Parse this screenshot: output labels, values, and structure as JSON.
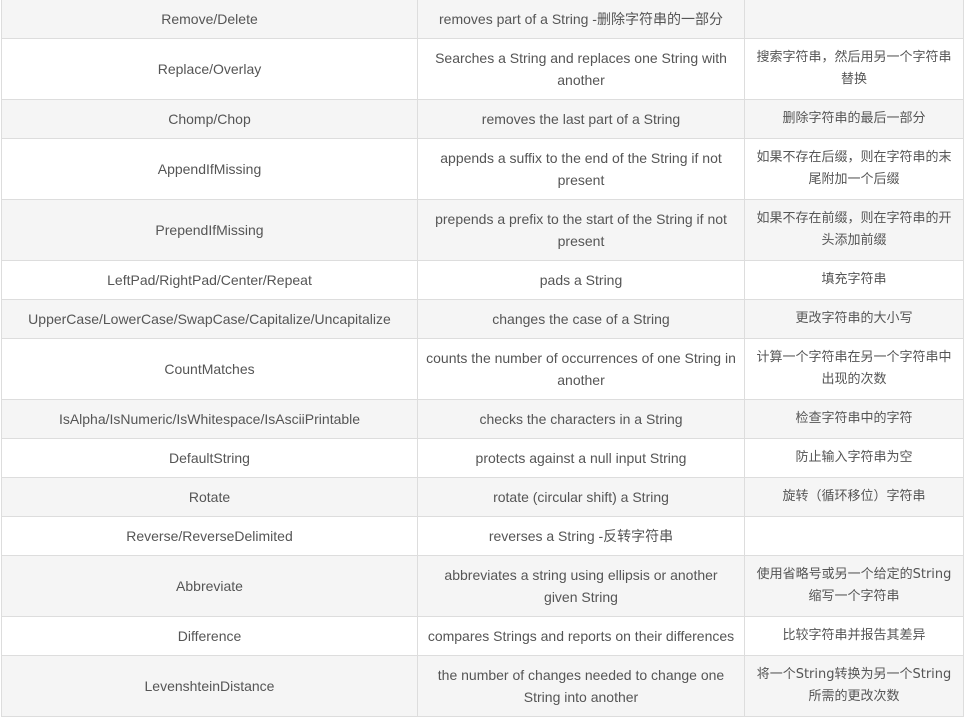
{
  "table": {
    "rows": [
      {
        "method": "Remove/Delete",
        "description": "removes part of a String -删除字符串的一部分",
        "chinese": ""
      },
      {
        "method": "Replace/Overlay",
        "description": "Searches a String and replaces one String with another",
        "chinese": "搜索字符串，然后用另一个字符串替换"
      },
      {
        "method": "Chomp/Chop",
        "description": "removes the last part of a String",
        "chinese": "删除字符串的最后一部分"
      },
      {
        "method": "AppendIfMissing",
        "description": "appends a suffix to the end of the String if not present",
        "chinese": "如果不存在后缀，则在字符串的末尾附加一个后缀"
      },
      {
        "method": "PrependIfMissing",
        "description": "prepends a prefix to the start of the String if not present",
        "chinese": "如果不存在前缀，则在字符串的开头添加前缀"
      },
      {
        "method": "LeftPad/RightPad/Center/Repeat",
        "description": "pads a String",
        "chinese": "填充字符串"
      },
      {
        "method": "UpperCase/LowerCase/SwapCase/Capitalize/Uncapitalize",
        "description": "changes the case of a String",
        "chinese": "更改字符串的大小写"
      },
      {
        "method": "CountMatches",
        "description": "counts the number of occurrences of one String in another",
        "chinese": "计算一个字符串在另一个字符串中出现的次数"
      },
      {
        "method": "IsAlpha/IsNumeric/IsWhitespace/IsAsciiPrintable",
        "description": "checks the characters in a String",
        "chinese": "检查字符串中的字符"
      },
      {
        "method": "DefaultString",
        "description": "protects against a null input String",
        "chinese": "防止输入字符串为空"
      },
      {
        "method": "Rotate",
        "description": "rotate (circular shift) a String",
        "chinese": "旋转（循环移位）字符串"
      },
      {
        "method": "Reverse/ReverseDelimited",
        "description": "reverses a String -反转字符串",
        "chinese": ""
      },
      {
        "method": "Abbreviate",
        "description": "abbreviates a string using ellipsis or another given String",
        "chinese": "使用省略号或另一个给定的String缩写一个字符串"
      },
      {
        "method": "Difference",
        "description": "compares Strings and reports on their differences",
        "chinese": "比较字符串并报告其差异"
      },
      {
        "method": "LevenshteinDistance",
        "description": "the number of changes needed to change one String into another",
        "chinese": "将一个String转换为另一个String所需的更改次数"
      }
    ]
  }
}
